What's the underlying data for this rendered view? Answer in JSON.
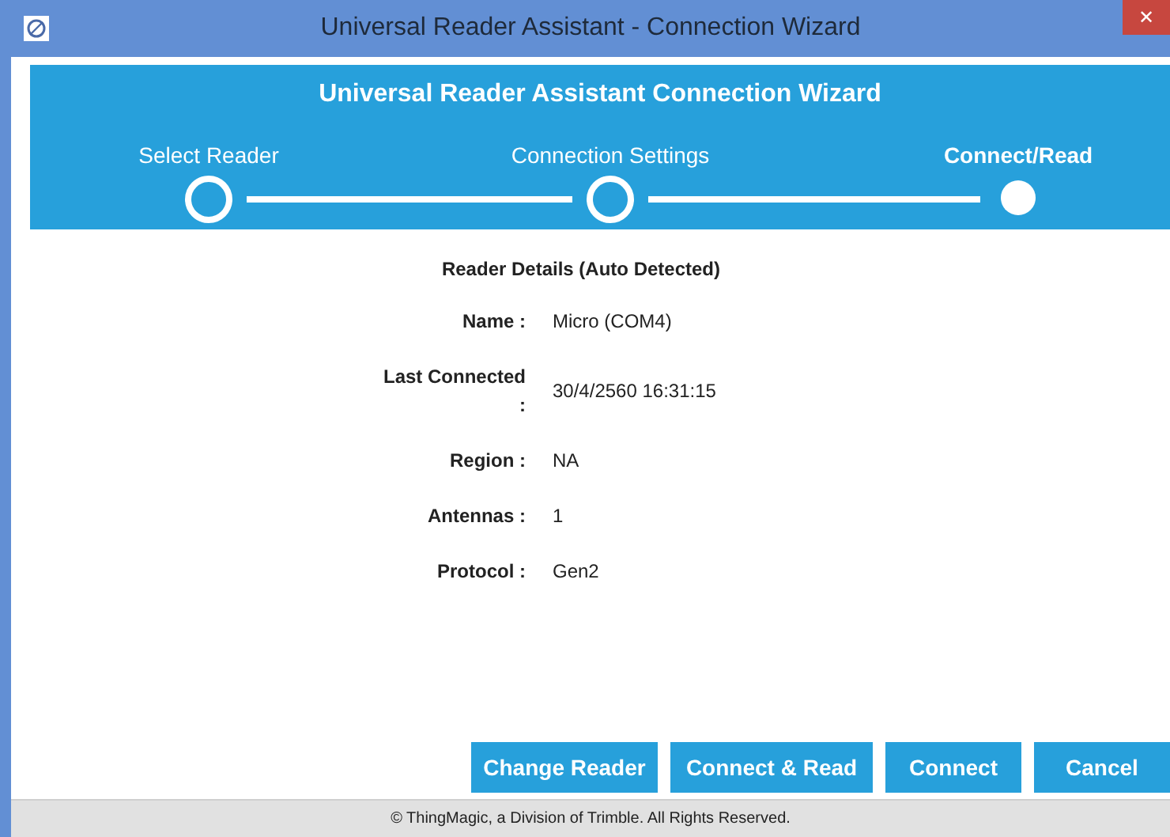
{
  "window": {
    "title": "Universal Reader Assistant - Connection Wizard",
    "close": "✕"
  },
  "header": {
    "title": "Universal Reader Assistant Connection Wizard",
    "steps": [
      {
        "label": "Select Reader",
        "selected": false
      },
      {
        "label": "Connection Settings",
        "selected": false
      },
      {
        "label": "Connect/Read",
        "selected": true
      }
    ]
  },
  "details": {
    "heading": "Reader Details (Auto Detected)",
    "rows": [
      {
        "label": "Name :",
        "value": "Micro (COM4)"
      },
      {
        "label": "Last Connected :",
        "value": "30/4/2560 16:31:15"
      },
      {
        "label": "Region :",
        "value": "NA"
      },
      {
        "label": "Antennas :",
        "value": "1"
      },
      {
        "label": "Protocol :",
        "value": "Gen2"
      }
    ]
  },
  "buttons": [
    "Change Reader",
    "Connect & Read",
    "Connect",
    "Cancel"
  ],
  "status_bar": "© ThingMagic, a Division of Trimble. All Rights Reserved."
}
